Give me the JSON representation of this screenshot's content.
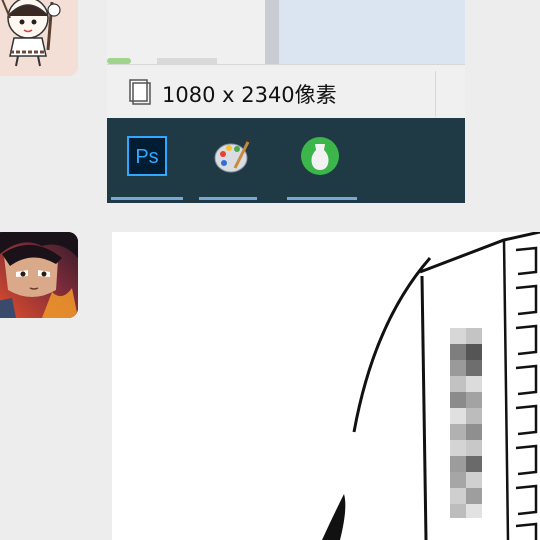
{
  "chat": {
    "image_message": {
      "status_bar": {
        "dimension_text": "1080 x 2340像素"
      },
      "taskbar": {
        "apps": [
          {
            "label": "Ps",
            "icon": "photoshop-icon",
            "color": "#31a8ff"
          },
          {
            "label": "",
            "icon": "paint-palette-icon"
          },
          {
            "label": "",
            "icon": "green-vase-app-icon",
            "color": "#3cb64a"
          }
        ]
      }
    },
    "avatars": [
      {
        "icon": "cartoon-girl-avatar"
      },
      {
        "icon": "anime-character-avatar"
      }
    ]
  },
  "colors": {
    "background": "#ededed",
    "taskbar": "#1f3a44",
    "taskbar_underline": "#76a9d3"
  }
}
